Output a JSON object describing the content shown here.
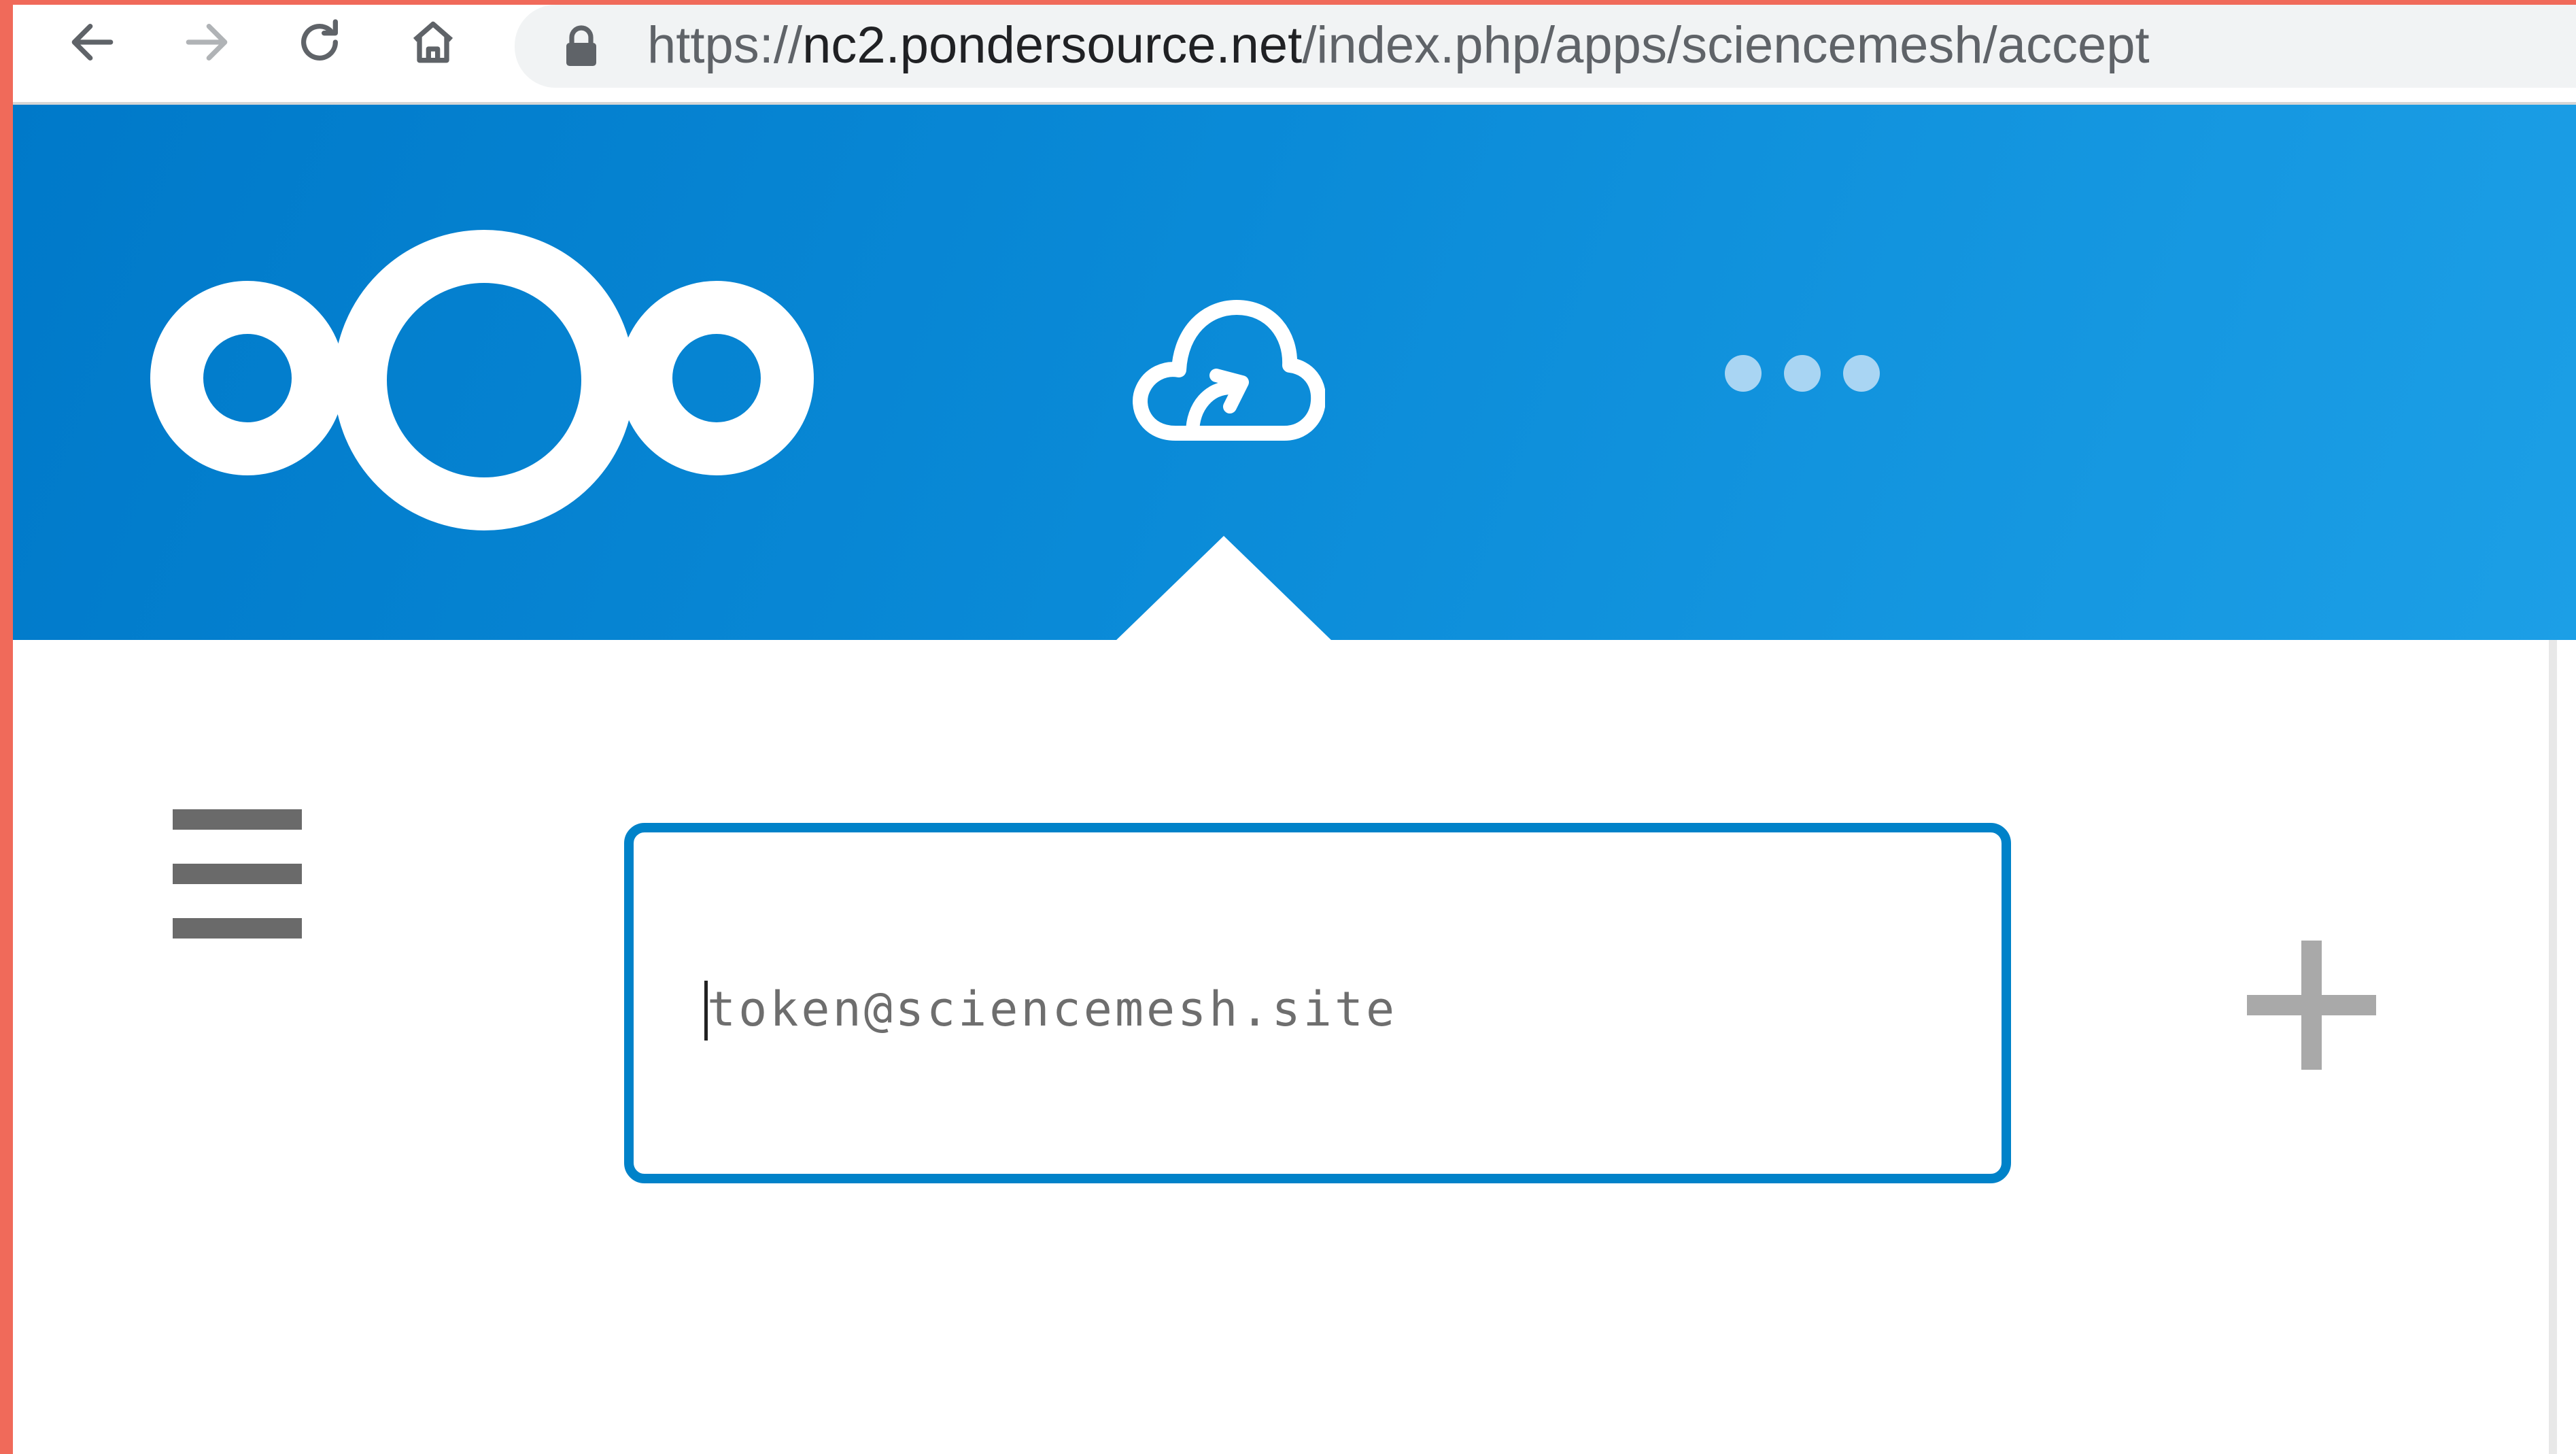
{
  "browser": {
    "url_scheme": "https://",
    "url_host": "nc2.pondersource.net",
    "url_path": "/index.php/apps/sciencemesh/accept",
    "buttons": [
      "back-arrow-icon",
      "forward-arrow-icon",
      "reload-icon",
      "home-icon"
    ],
    "secure_icon": "lock-icon"
  },
  "header": {
    "logo_icon": "nextcloud-logo",
    "active_app_icon": "cloud-upload-icon",
    "more_apps_icon": "more-dots-icon",
    "background": "#0082c9"
  },
  "main": {
    "menu_icon": "hamburger-icon",
    "token_input": {
      "placeholder": "token@sciencemesh.site",
      "value": ""
    },
    "add_icon": "plus-icon",
    "accent_color": "#0082c9"
  }
}
